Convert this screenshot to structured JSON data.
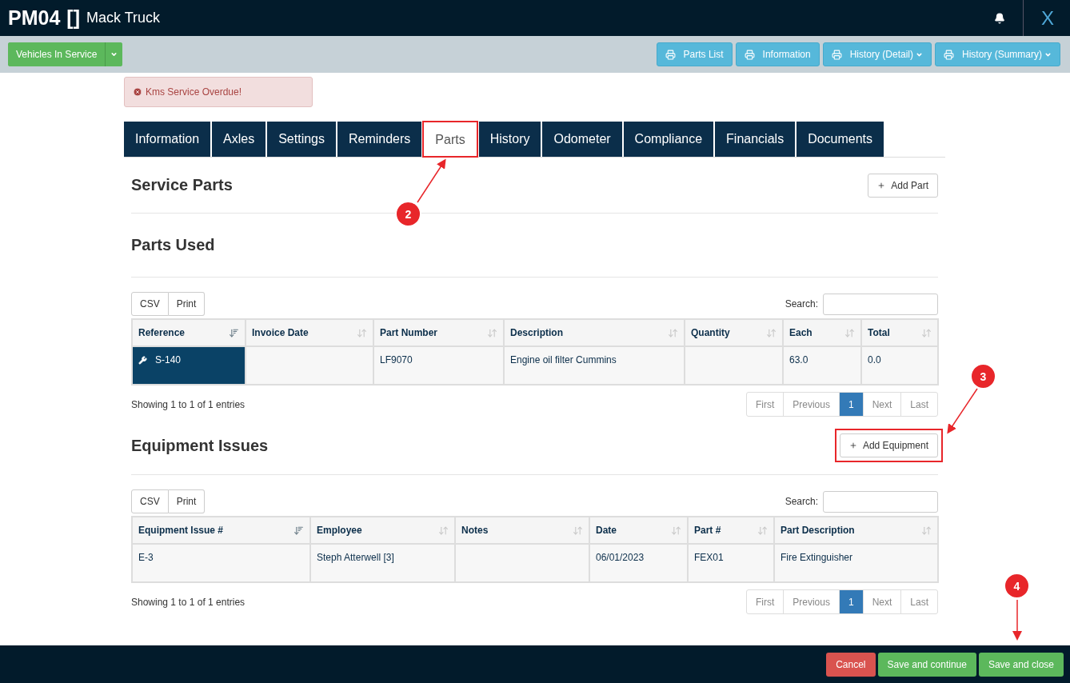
{
  "header": {
    "code": "PM04",
    "symbol": "[]",
    "name": "Mack Truck",
    "close": "X"
  },
  "toolbar": {
    "status_button": "Vehicles In Service",
    "print_buttons": [
      {
        "label": "Parts List",
        "dropdown": false
      },
      {
        "label": "Information",
        "dropdown": false
      },
      {
        "label": "History (Detail)",
        "dropdown": true
      },
      {
        "label": "History (Summary)",
        "dropdown": true
      }
    ]
  },
  "alert": "Kms Service Overdue!",
  "tabs": [
    {
      "label": "Information",
      "selected": false,
      "highlighted": false
    },
    {
      "label": "Axles",
      "selected": false,
      "highlighted": false
    },
    {
      "label": "Settings",
      "selected": false,
      "highlighted": false
    },
    {
      "label": "Reminders",
      "selected": false,
      "highlighted": false
    },
    {
      "label": "Parts",
      "selected": true,
      "highlighted": true
    },
    {
      "label": "History",
      "selected": false,
      "highlighted": false
    },
    {
      "label": "Odometer",
      "selected": false,
      "highlighted": false
    },
    {
      "label": "Compliance",
      "selected": false,
      "highlighted": false
    },
    {
      "label": "Financials",
      "selected": false,
      "highlighted": false
    },
    {
      "label": "Documents",
      "selected": false,
      "highlighted": false
    }
  ],
  "service_parts": {
    "title": "Service Parts",
    "button": {
      "label": "Add Part"
    }
  },
  "parts_used": {
    "title": "Parts Used",
    "exports": [
      "CSV",
      "Print"
    ],
    "search_label": "Search:",
    "columns": [
      {
        "label": "Reference",
        "sorted": true
      },
      {
        "label": "Invoice Date",
        "sorted": false
      },
      {
        "label": "Part Number",
        "sorted": false
      },
      {
        "label": "Description",
        "sorted": false
      },
      {
        "label": "Quantity",
        "sorted": false
      },
      {
        "label": "Each",
        "sorted": false
      },
      {
        "label": "Total",
        "sorted": false
      }
    ],
    "rows": [
      {
        "selected": true,
        "cells": [
          "S-140",
          "",
          "LF9070",
          "Engine oil filter Cummins",
          "",
          "63.0",
          "0.0"
        ]
      }
    ],
    "info": "Showing 1 to 1 of 1 entries",
    "pages": [
      {
        "label": "First",
        "selected": false
      },
      {
        "label": "Previous",
        "selected": false
      },
      {
        "label": "1",
        "selected": true
      },
      {
        "label": "Next",
        "selected": false
      },
      {
        "label": "Last",
        "selected": false
      }
    ]
  },
  "equipment_issues": {
    "title": "Equipment Issues",
    "button": {
      "label": "Add Equipment",
      "highlighted": true
    },
    "exports": [
      "CSV",
      "Print"
    ],
    "search_label": "Search:",
    "columns": [
      {
        "label": "Equipment Issue #",
        "sorted": true
      },
      {
        "label": "Employee",
        "sorted": false
      },
      {
        "label": "Notes",
        "sorted": false
      },
      {
        "label": "Date",
        "sorted": false
      },
      {
        "label": "Part #",
        "sorted": false
      },
      {
        "label": "Part Description",
        "sorted": false
      }
    ],
    "rows": [
      {
        "selected": false,
        "cells": [
          "E-3",
          "Steph Atterwell [3]",
          "",
          "06/01/2023",
          "FEX01",
          "Fire Extinguisher"
        ]
      }
    ],
    "info": "Showing 1 to 1 of 1 entries",
    "pages": [
      {
        "label": "First",
        "selected": false
      },
      {
        "label": "Previous",
        "selected": false
      },
      {
        "label": "1",
        "selected": true
      },
      {
        "label": "Next",
        "selected": false
      },
      {
        "label": "Last",
        "selected": false
      }
    ]
  },
  "footer": [
    {
      "label": "Cancel",
      "kind": "danger"
    },
    {
      "label": "Save and continue",
      "kind": "success"
    },
    {
      "label": "Save and close",
      "kind": "success"
    }
  ],
  "callouts": [
    {
      "number": "2"
    },
    {
      "number": "3"
    },
    {
      "number": "4"
    }
  ]
}
